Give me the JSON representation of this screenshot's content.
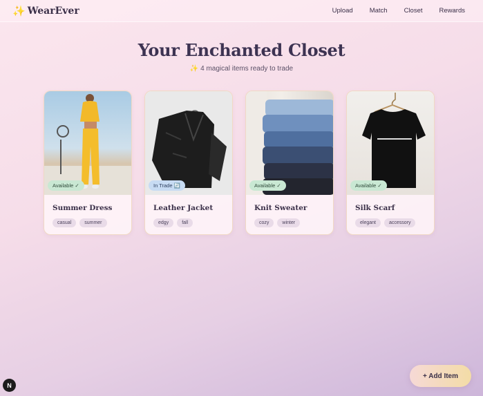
{
  "brand": {
    "name": "WearEver",
    "icon": "sparkle-icon"
  },
  "nav": {
    "items": [
      "Upload",
      "Match",
      "Closet",
      "Rewards"
    ]
  },
  "hero": {
    "title": "Your Enchanted Closet",
    "subtitle_icon": "✨",
    "subtitle": "4 magical items ready to trade"
  },
  "cards": [
    {
      "name": "Summer Dress",
      "status": "Available ✓",
      "tags": [
        "casual",
        "summer"
      ]
    },
    {
      "name": "Leather Jacket",
      "status": "In Trade 🔄",
      "tags": [
        "edgy",
        "fall"
      ]
    },
    {
      "name": "Knit Sweater",
      "status": "Available ✓",
      "tags": [
        "cozy",
        "winter"
      ]
    },
    {
      "name": "Silk Scarf",
      "status": "Available ✓",
      "tags": [
        "elegant",
        "accessory"
      ]
    }
  ],
  "actions": {
    "add_item": "+ Add Item"
  },
  "dev_badge": "N",
  "colors": {
    "available": "#c9e8d3",
    "in_trade": "#c7dbf3",
    "accent": "#e7b84a"
  }
}
